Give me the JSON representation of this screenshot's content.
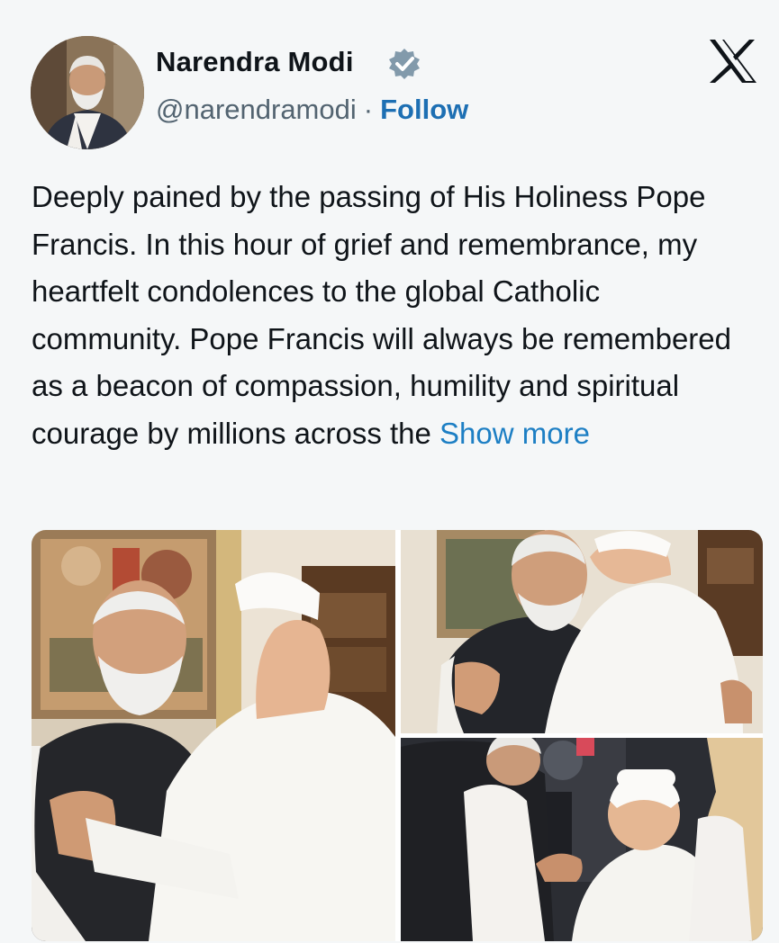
{
  "author": {
    "name": "Narendra Modi",
    "handle": "@narendramodi",
    "separator": "·",
    "follow_label": "Follow"
  },
  "tweet": {
    "text": "Deeply pained by the passing of His Holiness Pope Francis. In this hour of grief and remembrance, my heartfelt condolences to the global Catholic community. Pope Francis will always be remembered as a beacon of compassion, humility and spiritual courage by millions across the ",
    "show_more_label": "Show more"
  },
  "media": {
    "photos": [
      {
        "description_icon": "photo-embrace"
      },
      {
        "description_icon": "photo-hug"
      },
      {
        "description_icon": "photo-greeting"
      }
    ]
  },
  "icons": {
    "verified": "verified-badge-icon",
    "platform": "x-logo-icon"
  },
  "colors": {
    "follow": "#1d6fb3",
    "show_more": "#1d7fc4",
    "verified": "#829aab"
  }
}
